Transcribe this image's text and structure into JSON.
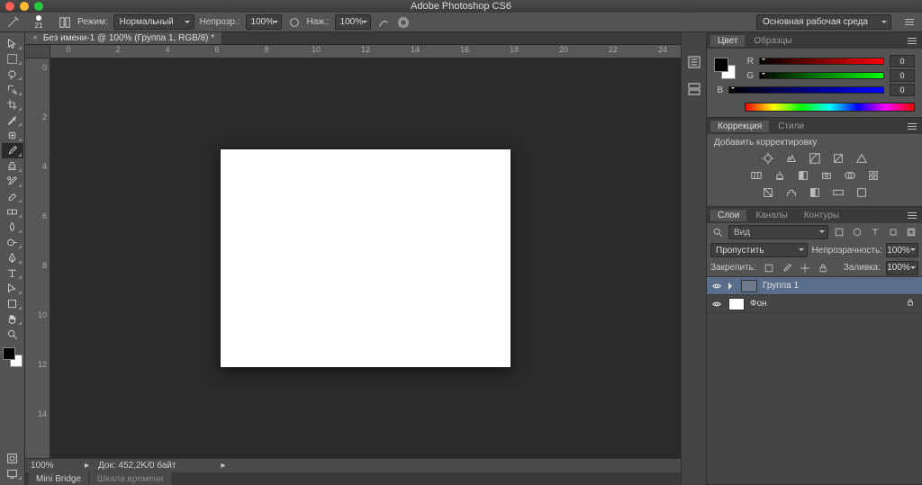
{
  "app": {
    "title": "Adobe Photoshop CS6"
  },
  "options": {
    "brush_size": "21",
    "mode_label": "Режим:",
    "mode": "Нормальный",
    "opacity_label": "Непрозр.:",
    "opacity": "100%",
    "flow_label": "Наж.:",
    "flow": "100%",
    "workspace": "Основная рабочая среда"
  },
  "document": {
    "tab_title": "Без имени-1 @ 100% (Группа 1, RGB/8) *"
  },
  "rulers": {
    "h": [
      "0",
      "2",
      "4",
      "6",
      "8",
      "10",
      "12",
      "14",
      "16",
      "18",
      "20",
      "22",
      "24"
    ],
    "v": [
      "0",
      "2",
      "4",
      "6",
      "8",
      "10",
      "12",
      "14"
    ]
  },
  "statusbar": {
    "zoom": "100%",
    "info": "Док: 452,2K/0 байт"
  },
  "bottom_tabs": {
    "mini_bridge": "Mini Bridge",
    "timeline": "Шкала времени"
  },
  "color_panel": {
    "tabs": {
      "color": "Цвет",
      "swatches": "Образцы"
    },
    "r_label": "R",
    "g_label": "G",
    "b_label": "B",
    "r": "0",
    "g": "0",
    "b": "0"
  },
  "corrections_panel": {
    "tabs": {
      "corrections": "Коррекция",
      "styles": "Стили"
    },
    "add_label": "Добавить корректировку"
  },
  "layers_panel": {
    "tabs": {
      "layers": "Слои",
      "channels": "Каналы",
      "paths": "Контуры"
    },
    "filter_kind": "Вид",
    "blend_mode": "Пропустить",
    "opacity_label": "Непрозрачность:",
    "opacity": "100%",
    "lock_label": "Закрепить:",
    "fill_label": "Заливка:",
    "fill": "100%",
    "layers": [
      {
        "name": "Группа 1",
        "type": "group",
        "selected": true
      },
      {
        "name": "Фон",
        "type": "bg",
        "locked": true
      }
    ]
  }
}
